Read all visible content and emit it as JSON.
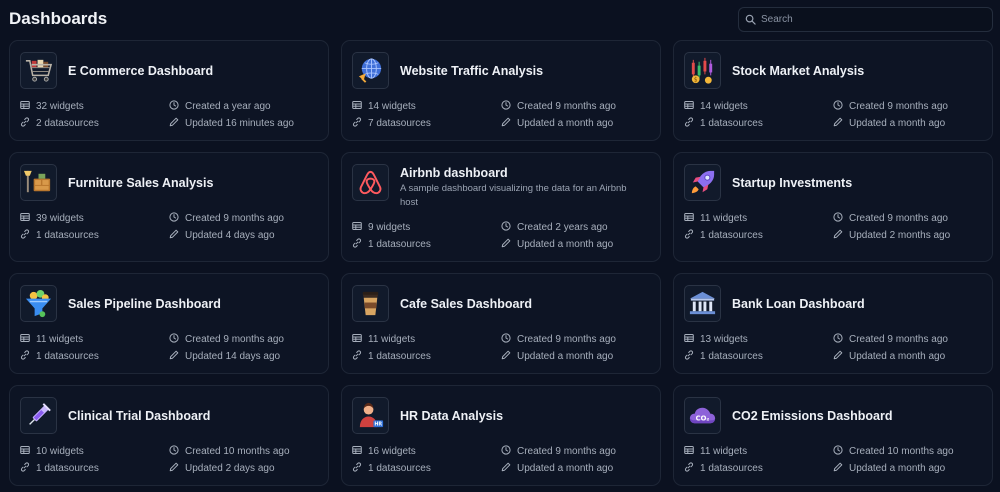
{
  "header": {
    "title": "Dashboards",
    "search_placeholder": "Search"
  },
  "dashboards": [
    {
      "title": "E Commerce Dashboard",
      "description": "",
      "icon": "shopping-cart-icon",
      "widgets": "32 widgets",
      "datasources": "2 datasources",
      "created": "Created a year ago",
      "updated": "Updated 16 minutes ago"
    },
    {
      "title": "Website Traffic Analysis",
      "description": "",
      "icon": "globe-cursor-icon",
      "widgets": "14 widgets",
      "datasources": "7 datasources",
      "created": "Created 9 months ago",
      "updated": "Updated a month ago"
    },
    {
      "title": "Stock Market Analysis",
      "description": "",
      "icon": "stock-chart-icon",
      "widgets": "14 widgets",
      "datasources": "1 datasources",
      "created": "Created 9 months ago",
      "updated": "Updated a month ago"
    },
    {
      "title": "Furniture Sales Analysis",
      "description": "",
      "icon": "furniture-icon",
      "widgets": "39 widgets",
      "datasources": "1 datasources",
      "created": "Created 9 months ago",
      "updated": "Updated 4 days ago"
    },
    {
      "title": "Airbnb dashboard",
      "description": "A sample dashboard visualizing the data for an Airbnb host",
      "icon": "airbnb-logo-icon",
      "widgets": "9 widgets",
      "datasources": "1 datasources",
      "created": "Created 2 years ago",
      "updated": "Updated a month ago"
    },
    {
      "title": "Startup Investments",
      "description": "",
      "icon": "rocket-icon",
      "widgets": "11 widgets",
      "datasources": "1 datasources",
      "created": "Created 9 months ago",
      "updated": "Updated 2 months ago"
    },
    {
      "title": "Sales Pipeline Dashboard",
      "description": "",
      "icon": "funnel-icon",
      "widgets": "11 widgets",
      "datasources": "1 datasources",
      "created": "Created 9 months ago",
      "updated": "Updated 14 days ago"
    },
    {
      "title": "Cafe Sales Dashboard",
      "description": "",
      "icon": "coffee-cup-icon",
      "widgets": "11 widgets",
      "datasources": "1 datasources",
      "created": "Created 9 months ago",
      "updated": "Updated a month ago"
    },
    {
      "title": "Bank Loan Dashboard",
      "description": "",
      "icon": "bank-icon",
      "widgets": "13 widgets",
      "datasources": "1 datasources",
      "created": "Created 9 months ago",
      "updated": "Updated a month ago"
    },
    {
      "title": "Clinical Trial Dashboard",
      "description": "",
      "icon": "syringe-icon",
      "widgets": "10 widgets",
      "datasources": "1 datasources",
      "created": "Created 10 months ago",
      "updated": "Updated 2 days ago"
    },
    {
      "title": "HR Data Analysis",
      "description": "",
      "icon": "hr-person-icon",
      "widgets": "16 widgets",
      "datasources": "1 datasources",
      "created": "Created 9 months ago",
      "updated": "Updated a month ago"
    },
    {
      "title": "CO2 Emissions Dashboard",
      "description": "",
      "icon": "co2-cloud-icon",
      "widgets": "11 widgets",
      "datasources": "1 datasources",
      "created": "Created 10 months ago",
      "updated": "Updated a month ago"
    }
  ],
  "icon_glyphs": {
    "co2_label": "CO₂",
    "hr_label": "HR"
  }
}
